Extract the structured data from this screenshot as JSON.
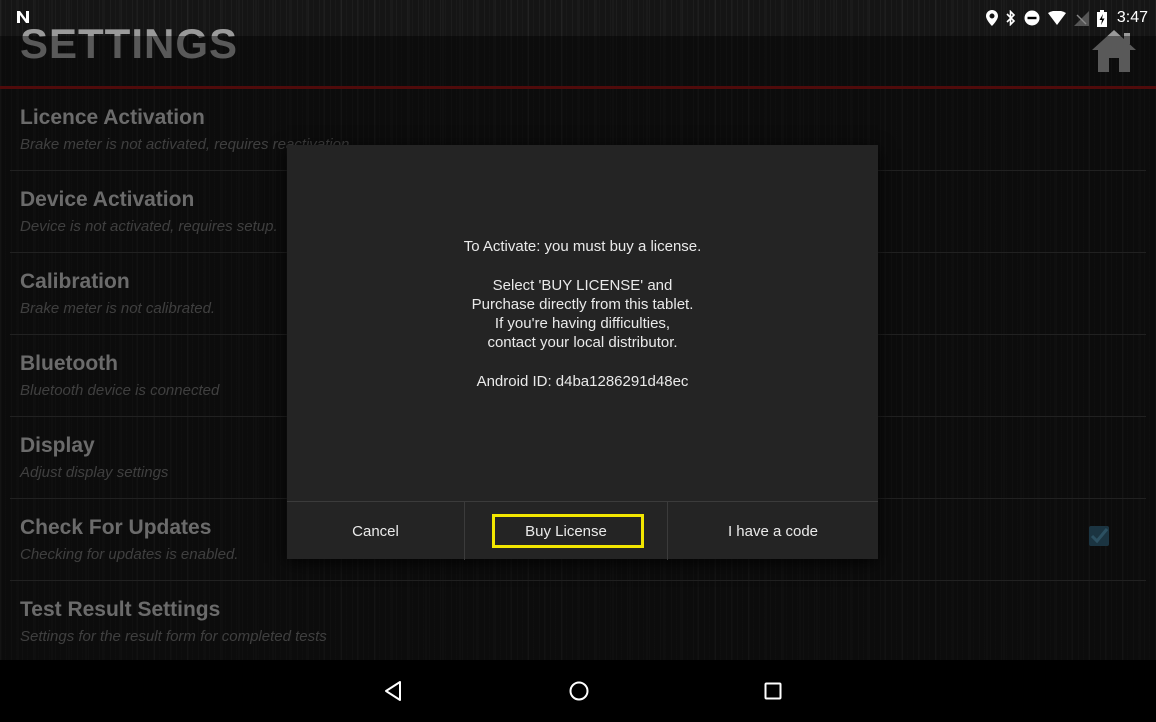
{
  "status_bar": {
    "time": "3:47",
    "icons": [
      "n-notification-icon",
      "location-icon",
      "bluetooth-icon",
      "do-not-disturb-icon",
      "wifi-icon",
      "no-signal-icon",
      "battery-charging-icon"
    ]
  },
  "header": {
    "title": "SETTINGS",
    "home_icon": "home-icon",
    "accent_color": "#8a1414"
  },
  "settings": {
    "items": [
      {
        "title": "Licence Activation",
        "summary": "Brake meter is not activated, requires reactivation."
      },
      {
        "title": "Device Activation",
        "summary": "Device is not activated, requires setup."
      },
      {
        "title": "Calibration",
        "summary": "Brake meter is not calibrated."
      },
      {
        "title": "Bluetooth",
        "summary": "Bluetooth device is connected"
      },
      {
        "title": "Display",
        "summary": "Adjust display settings"
      },
      {
        "title": "Check For Updates",
        "summary": "Checking for updates is enabled.",
        "checked": true
      },
      {
        "title": "Test Result Settings",
        "summary": "Settings for the result form for completed tests"
      }
    ]
  },
  "dialog": {
    "line1": "To Activate: you must buy a license.",
    "line2": "Select 'BUY LICENSE' and",
    "line3": "Purchase directly from this tablet.",
    "line4": "If you're having difficulties,",
    "line5": "contact your local distributor.",
    "android_id": "Android ID: d4ba1286291d48ec",
    "buttons": {
      "cancel": "Cancel",
      "buy_license": "Buy License",
      "have_code": "I have a code"
    },
    "highlight_color": "#f2e600"
  },
  "nav_bar": {
    "icons": [
      "back-icon",
      "home-circle-icon",
      "recents-icon"
    ]
  }
}
